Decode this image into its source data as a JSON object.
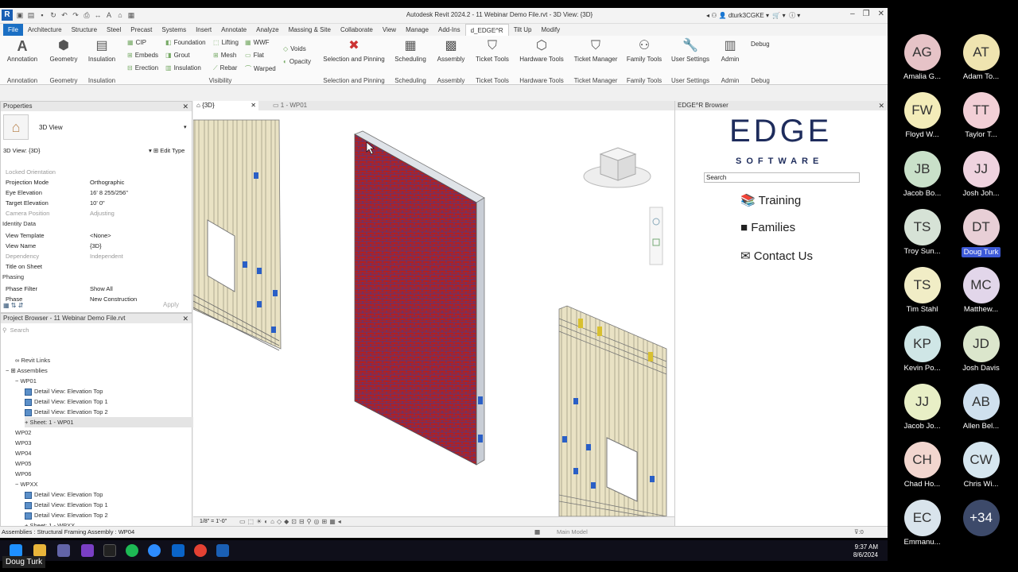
{
  "window": {
    "title": "Autodesk Revit 2024.2 - 11 Webinar Demo File.rvt - 3D View: {3D}",
    "user": "dturk3CGKE"
  },
  "menu_tabs": [
    "File",
    "Architecture",
    "Structure",
    "Steel",
    "Precast",
    "Systems",
    "Insert",
    "Annotate",
    "Analyze",
    "Massing & Site",
    "Collaborate",
    "View",
    "Manage",
    "Add-Ins",
    "d_EDGE^R",
    "Tilt Up",
    "Modify"
  ],
  "ribbon": {
    "big_buttons": [
      "Annotation",
      "Geometry",
      "Insulation"
    ],
    "small_col1": [
      "CIP",
      "Embeds",
      "Erection"
    ],
    "small_col2": [
      "Foundation",
      "Grout",
      "Insulation"
    ],
    "small_col3": [
      "Lifting",
      "Mesh",
      "Rebar"
    ],
    "small_col4": [
      "WWF",
      "Flat",
      "Warped"
    ],
    "small_col5": [
      "Voids",
      "Opacity"
    ],
    "tools": [
      "Selection and Pinning",
      "Scheduling",
      "Assembly",
      "Ticket Tools",
      "Hardware Tools",
      "Ticket Manager",
      "Family Tools",
      "User Settings",
      "Admin",
      "Debug"
    ],
    "panels": [
      "Annotation",
      "Geometry",
      "Insulation",
      "Visibility",
      "Selection and Pinning",
      "Scheduling",
      "Assembly",
      "Ticket Tools",
      "Hardware Tools",
      "Ticket Manager",
      "Family Tools",
      "User Settings",
      "Admin",
      "Debug"
    ]
  },
  "properties": {
    "title": "Properties",
    "type": "3D View",
    "selector": "3D View: {3D}",
    "edit_type": "Edit Type",
    "rows": [
      {
        "k": "Locked Orientation",
        "v": ""
      },
      {
        "k": "Projection Mode",
        "v": "Orthographic"
      },
      {
        "k": "Eye Elevation",
        "v": "16'  8 255/256\""
      },
      {
        "k": "Target Elevation",
        "v": "10'  0\""
      },
      {
        "k": "Camera Position",
        "v": "Adjusting"
      }
    ],
    "identity_header": "Identity Data",
    "identity_rows": [
      {
        "k": "View Template",
        "v": "<None>"
      },
      {
        "k": "View Name",
        "v": "{3D}"
      },
      {
        "k": "Dependency",
        "v": "Independent"
      },
      {
        "k": "Title on Sheet",
        "v": ""
      }
    ],
    "phasing_header": "Phasing",
    "phasing_rows": [
      {
        "k": "Phase Filter",
        "v": "Show All"
      },
      {
        "k": "Phase",
        "v": "New Construction"
      }
    ],
    "apply": "Apply"
  },
  "project_browser": {
    "title": "Project Browser - 11 Webinar Demo File.rvt",
    "search_placeholder": "Search",
    "items": [
      {
        "t": "Revit Links",
        "lvl": 1
      },
      {
        "t": "Assemblies",
        "lvl": 0
      },
      {
        "t": "WP01",
        "lvl": 1
      },
      {
        "t": "Detail View: Elevation Top",
        "lvl": 2
      },
      {
        "t": "Detail View: Elevation Top 1",
        "lvl": 2
      },
      {
        "t": "Detail View: Elevation Top 2",
        "lvl": 2
      },
      {
        "t": "Sheet: 1 - WP01",
        "lvl": 2
      },
      {
        "t": "WP02",
        "lvl": 1
      },
      {
        "t": "WP03",
        "lvl": 1
      },
      {
        "t": "WP04",
        "lvl": 1
      },
      {
        "t": "WP05",
        "lvl": 1
      },
      {
        "t": "WP06",
        "lvl": 1
      },
      {
        "t": "WPXX",
        "lvl": 1
      },
      {
        "t": "Detail View: Elevation Top",
        "lvl": 2
      },
      {
        "t": "Detail View: Elevation Top 1",
        "lvl": 2
      },
      {
        "t": "Detail View: Elevation Top 2",
        "lvl": 2
      },
      {
        "t": "Sheet: 1 - WPXX",
        "lvl": 2
      }
    ]
  },
  "view_tabs": [
    "{3D}",
    "1 - WP01"
  ],
  "view_scale": "1/8\" = 1'-0\"",
  "edge_browser": {
    "title": "EDGE^R Browser",
    "logo": "EDGE",
    "logo_sub": "SOFTWARE",
    "search_value": "Search",
    "links": [
      "Training",
      "Families",
      "Contact Us"
    ]
  },
  "status": {
    "left": "Assemblies : Structural Framing Assembly : WP04",
    "model": "Main Model",
    "filter": ":0"
  },
  "taskbar": {
    "time": "9:37 AM",
    "date": "8/6/2024"
  },
  "active_speaker": "Doug Turk",
  "participants": [
    {
      "i": "AG",
      "n": "Amalia G...",
      "c": "#e6c3c7"
    },
    {
      "i": "AT",
      "n": "Adam To...",
      "c": "#efe4b0"
    },
    {
      "i": "FW",
      "n": "Floyd W...",
      "c": "#f3ecb9"
    },
    {
      "i": "TT",
      "n": "Taylor T...",
      "c": "#f2cfd6"
    },
    {
      "i": "JB",
      "n": "Jacob Bo...",
      "c": "#c9e0c9"
    },
    {
      "i": "JJ",
      "n": "Josh Joh...",
      "c": "#efd3df"
    },
    {
      "i": "TS",
      "n": "Troy Sun...",
      "c": "#d6e2d6"
    },
    {
      "i": "DT",
      "n": "Doug Turk",
      "c": "#e8cfd6"
    },
    {
      "i": "TS",
      "n": "Tim Stahl",
      "c": "#f1edc6"
    },
    {
      "i": "MC",
      "n": "Matthew...",
      "c": "#e2d6ea"
    },
    {
      "i": "KP",
      "n": "Kevin Po...",
      "c": "#cfe6e6"
    },
    {
      "i": "JD",
      "n": "Josh Davis",
      "c": "#dbe6cc"
    },
    {
      "i": "JJ",
      "n": "Jacob Jo...",
      "c": "#e8efc6"
    },
    {
      "i": "AB",
      "n": "Allen Bel...",
      "c": "#cfe0ee"
    },
    {
      "i": "CH",
      "n": "Chad Ho...",
      "c": "#f2d6cf"
    },
    {
      "i": "CW",
      "n": "Chris Wi...",
      "c": "#d6e6ef"
    },
    {
      "i": "EC",
      "n": "Emmanu...",
      "c": "#d9e4ec"
    },
    {
      "i": "+34",
      "n": "",
      "c": "#3d4a6a"
    }
  ]
}
